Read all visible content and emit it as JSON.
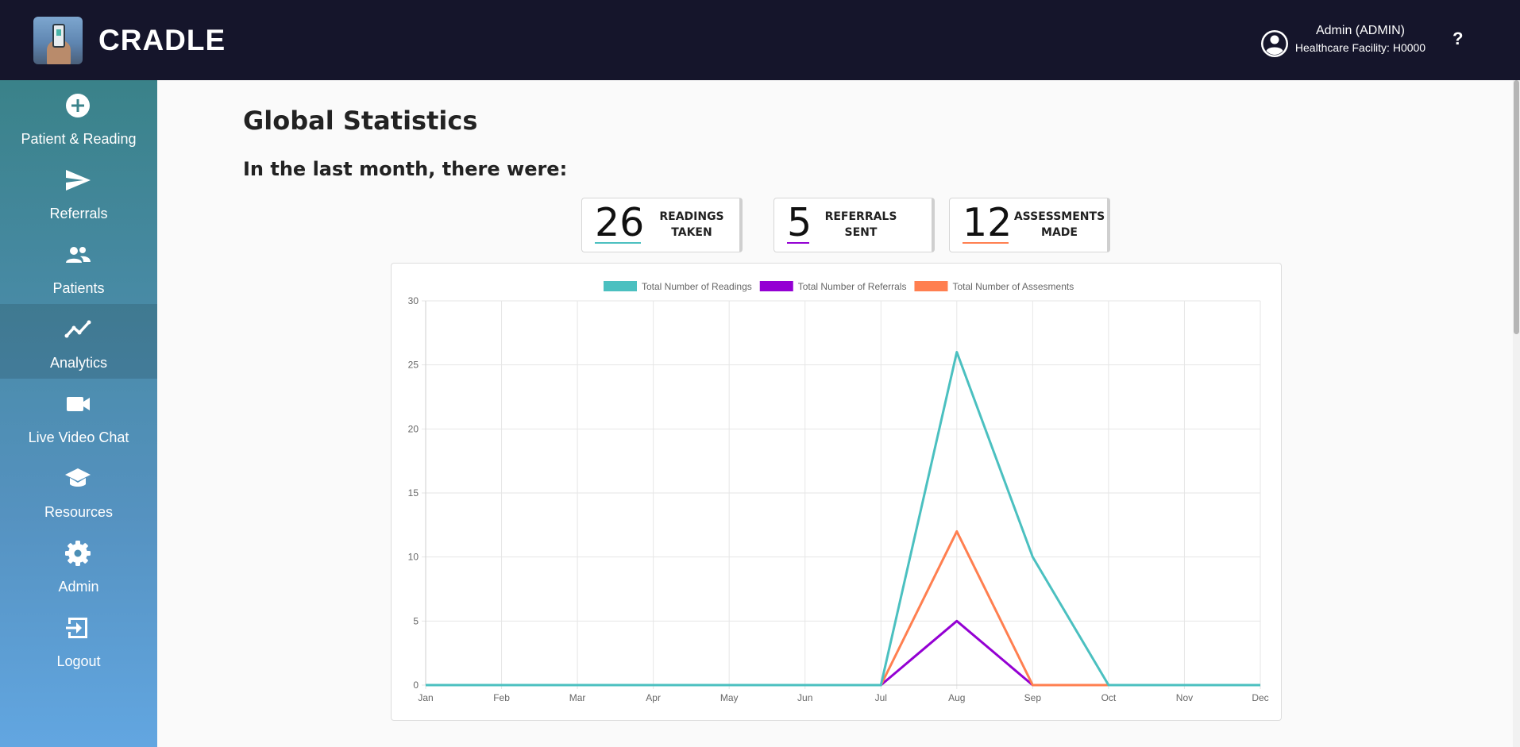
{
  "header": {
    "brand": "CRADLE",
    "user_name": "Admin (ADMIN)",
    "facility": "Healthcare Facility: H0000",
    "help_label": "?"
  },
  "sidebar": {
    "items": [
      {
        "label": "Patient & Reading",
        "icon": "plus-circle-icon"
      },
      {
        "label": "Referrals",
        "icon": "send-icon"
      },
      {
        "label": "Patients",
        "icon": "people-icon"
      },
      {
        "label": "Analytics",
        "icon": "analytics-icon",
        "active": true
      },
      {
        "label": "Live Video Chat",
        "icon": "video-icon"
      },
      {
        "label": "Resources",
        "icon": "school-icon"
      },
      {
        "label": "Admin",
        "icon": "gear-icon"
      },
      {
        "label": "Logout",
        "icon": "logout-icon"
      }
    ]
  },
  "main": {
    "title": "Global Statistics",
    "subtitle": "In the last month, there were:",
    "stats": [
      {
        "value": "26",
        "label_line1": "READINGS",
        "label_line2": "TAKEN",
        "color": "#4bc0c0"
      },
      {
        "value": "5",
        "label_line1": "REFERRALS",
        "label_line2": "SENT",
        "color": "#9400d3"
      },
      {
        "value": "12",
        "label_line1": "ASSESSMENTS",
        "label_line2": "MADE",
        "color": "#ff7f50"
      }
    ]
  },
  "colors": {
    "header_bg": "#15152b",
    "readings": "#4bc0c0",
    "referrals": "#9400d3",
    "assessments": "#ff7f50"
  },
  "chart_data": {
    "type": "line",
    "categories": [
      "Jan",
      "Feb",
      "Mar",
      "Apr",
      "May",
      "Jun",
      "Jul",
      "Aug",
      "Sep",
      "Oct",
      "Nov",
      "Dec"
    ],
    "series": [
      {
        "name": "Total Number of Readings",
        "color": "#4bc0c0",
        "values": [
          0,
          0,
          0,
          0,
          0,
          0,
          0,
          26,
          10,
          0,
          0,
          0
        ]
      },
      {
        "name": "Total Number of Referrals",
        "color": "#9400d3",
        "values": [
          0,
          0,
          0,
          0,
          0,
          0,
          0,
          5,
          0,
          0,
          0,
          0
        ]
      },
      {
        "name": "Total Number of Assesments",
        "color": "#ff7f50",
        "values": [
          0,
          0,
          0,
          0,
          0,
          0,
          0,
          12,
          0,
          0,
          0,
          0
        ]
      }
    ],
    "ylim": [
      0,
      30
    ],
    "yticks": [
      0,
      5,
      10,
      15,
      20,
      25,
      30
    ],
    "grid": true,
    "legend_position": "top"
  }
}
